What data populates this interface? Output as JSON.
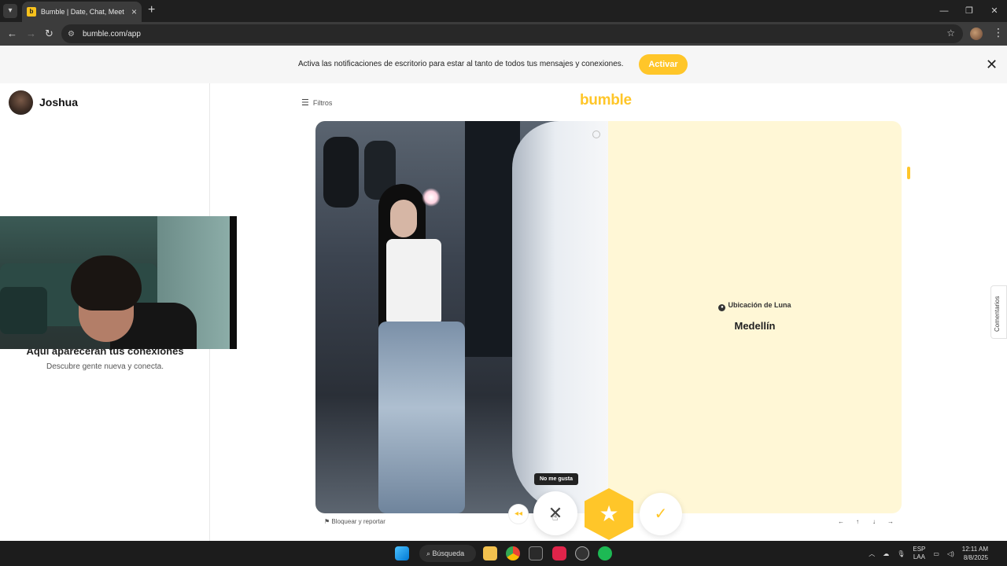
{
  "browser": {
    "tab_title": "Bumble | Date, Chat, Meet New",
    "url": "bumble.com/app"
  },
  "banner": {
    "text": "Activa las notificaciones de escritorio para estar al tanto de todos tus mensajes y conexiones.",
    "button": "Activar"
  },
  "sidebar": {
    "user_name": "Joshua",
    "empty_title": "Aquí aparecerán tus conexiones",
    "empty_subtitle": "Descubre gente nueva y conecta."
  },
  "main": {
    "filters_label": "Filtros",
    "logo": "bumble",
    "location_label": "Ubicación de Luna",
    "location_value": "Medellín",
    "block_report": "Bloquear y reportar",
    "tooltip": "No me gusta",
    "feedback_tab": "Comentarios"
  },
  "taskbar": {
    "search": "Búsqueda",
    "lang": "ESP",
    "lang2": "LAA",
    "time": "12:11 AM",
    "date": "8/8/2025"
  },
  "colors": {
    "brand": "#ffc629",
    "card_bg": "#fff7d6"
  }
}
